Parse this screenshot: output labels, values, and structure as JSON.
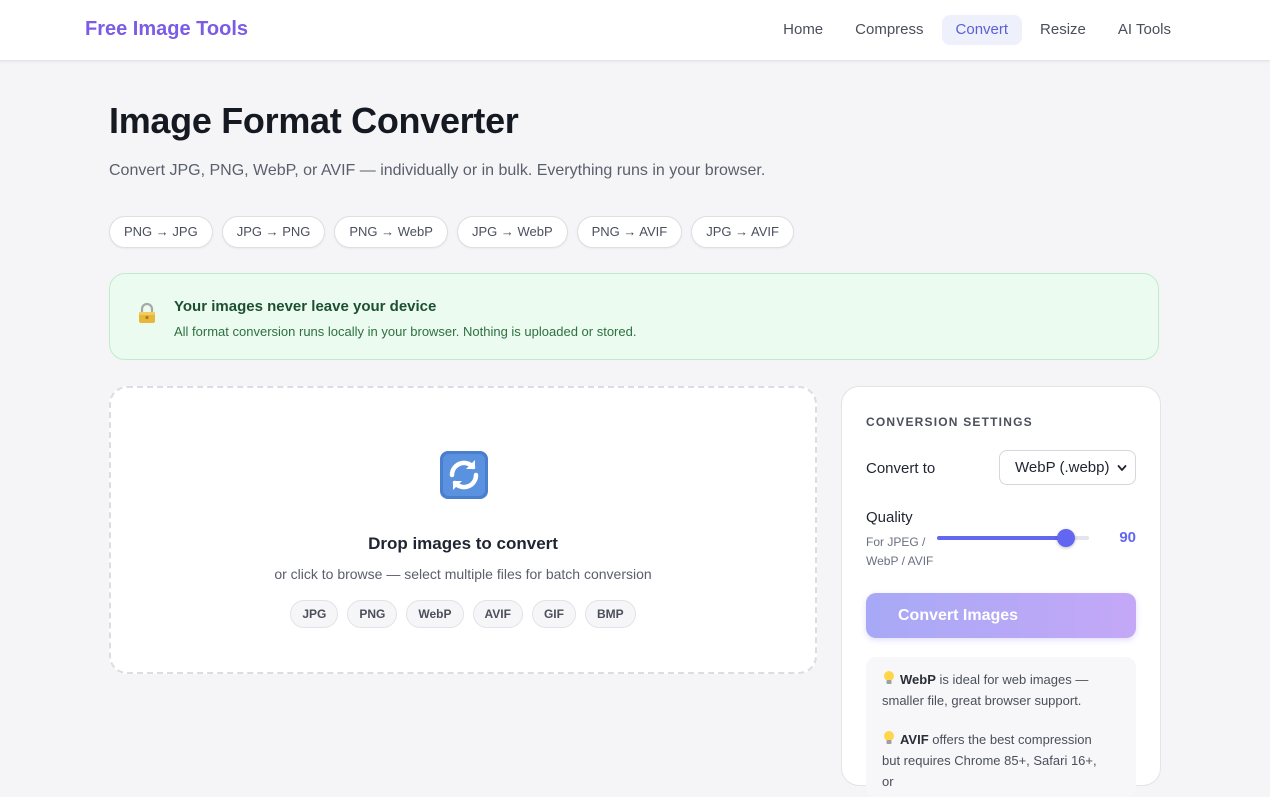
{
  "header": {
    "logo": "Free Image Tools",
    "nav": [
      {
        "label": "Home",
        "active": false
      },
      {
        "label": "Compress",
        "active": false
      },
      {
        "label": "Convert",
        "active": true
      },
      {
        "label": "Resize",
        "active": false
      },
      {
        "label": "AI Tools",
        "active": false
      }
    ]
  },
  "main": {
    "title": "Image Format Converter",
    "subtitle": "Convert JPG, PNG, WebP, or AVIF — individually or in bulk. Everything runs in your browser.",
    "quick_links": [
      "PNG → JPG",
      "JPG → PNG",
      "PNG → WebP",
      "JPG → WebP",
      "PNG → AVIF",
      "JPG → AVIF"
    ]
  },
  "privacy": {
    "icon": "lock-icon",
    "title": "Your images never leave your device",
    "text": "All format conversion runs locally in your browser. Nothing is uploaded or stored.",
    "colors": {
      "background": "#ebfbf0",
      "title": "#1d4f31",
      "text": "#2e7040"
    }
  },
  "dropzone": {
    "icon": "convert-arrows-icon",
    "title": "Drop images to convert",
    "subtitle": "or click to browse — select multiple files for batch conversion",
    "formats": [
      "JPG",
      "PNG",
      "WebP",
      "AVIF",
      "GIF",
      "BMP"
    ]
  },
  "settings": {
    "heading": "CONVERSION SETTINGS",
    "convert_to_label": "Convert to",
    "convert_to_value": "WebP (.webp)",
    "quality_label": "Quality",
    "quality_hint": "For JPEG / WebP / AVIF",
    "quality_value": "90",
    "quality_fraction": 0.85,
    "button_label": "Convert Images",
    "tips": [
      {
        "bold": "WebP",
        "text": " is ideal for web images — smaller file, great browser support."
      },
      {
        "bold": "AVIF",
        "text": " offers the best compression but requires Chrome 85+, Safari 16+, or"
      }
    ]
  },
  "colors": {
    "brand": "#7c5ce6",
    "accent": "#6366f1",
    "nav_active_bg": "#eef0fc"
  }
}
